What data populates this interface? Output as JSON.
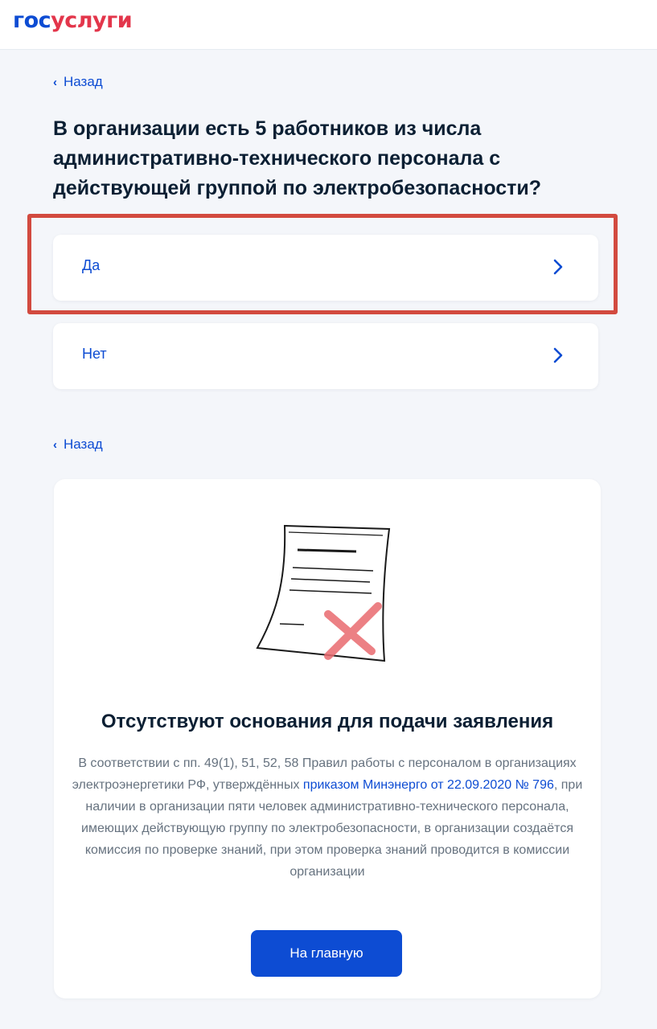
{
  "header": {
    "logo_part1": "гос",
    "logo_part2": "услуги"
  },
  "back_link_top": {
    "label": "Назад",
    "icon": "chevron-left-icon"
  },
  "question": {
    "text": "В организации есть 5 работников из числа административно-технического персонала с действующей группой по электробезопасности?"
  },
  "options": [
    {
      "label": "Да",
      "icon": "chevron-right-icon",
      "highlighted": true
    },
    {
      "label": "Нет",
      "icon": "chevron-right-icon",
      "highlighted": false
    }
  ],
  "back_link_bottom": {
    "label": "Назад",
    "icon": "chevron-left-icon"
  },
  "result": {
    "illustration": "rejected-document-icon",
    "title": "Отсутствуют основания для подачи заявления",
    "text_before_link": "В соответствии с пп. 49(1), 51, 52, 58 Правил работы с персоналом в организациях электроэнергетики РФ, утверждённых ",
    "link_text": "приказом Минэнерго от 22.09.2020 № 796",
    "text_after_link": ", при наличии в организации пяти человек административно-технического персонала, имеющих действующую группу по электробезопасности, в организации создаётся комиссия по проверке знаний, при этом проверка знаний проводится в комиссии организации",
    "button_label": "На главную"
  },
  "colors": {
    "accent": "#0d4cd3",
    "logo_red": "#e3364b",
    "highlight_border": "#d24a3f",
    "page_bg": "#f4f6fa"
  }
}
